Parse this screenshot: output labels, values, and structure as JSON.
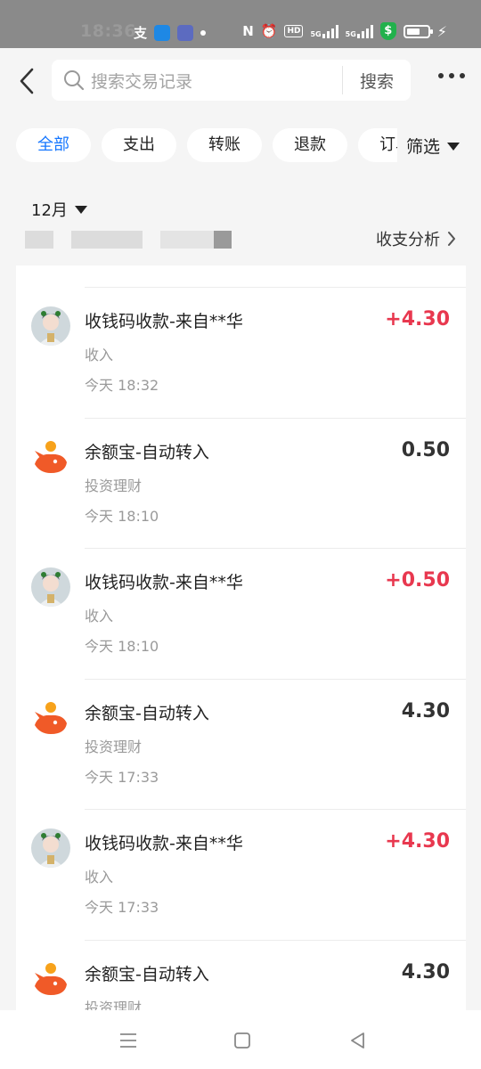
{
  "status_bar": {
    "time": "18:36",
    "network_label": "5G",
    "hd_label": "HD",
    "shield_symbol": "$"
  },
  "header": {
    "search_placeholder": "搜索交易记录",
    "search_button": "搜索"
  },
  "tabs": [
    "全部",
    "支出",
    "转账",
    "退款",
    "订单"
  ],
  "active_tab": "全部",
  "filter_label": "筛选",
  "month_label": "12月",
  "analysis_label": "收支分析",
  "colors": {
    "accent": "#1677ff",
    "income": "#e8384f",
    "yuebao": "#f05a28"
  },
  "transactions": [
    {
      "title": "收钱码收款-来自**华",
      "category": "收入",
      "time": "今天 18:32",
      "amount": "+4.30",
      "icon": "user-avatar"
    },
    {
      "title": "余额宝-自动转入",
      "category": "投资理财",
      "time": "今天 18:10",
      "amount": "0.50",
      "icon": "yuebao-icon"
    },
    {
      "title": "收钱码收款-来自**华",
      "category": "收入",
      "time": "今天 18:10",
      "amount": "+0.50",
      "icon": "user-avatar"
    },
    {
      "title": "余额宝-自动转入",
      "category": "投资理财",
      "time": "今天 17:33",
      "amount": "4.30",
      "icon": "yuebao-icon"
    },
    {
      "title": "收钱码收款-来自**华",
      "category": "收入",
      "time": "今天 17:33",
      "amount": "+4.30",
      "icon": "user-avatar"
    },
    {
      "title": "余额宝-自动转入",
      "category": "投资理财",
      "time": "",
      "amount": "4.30",
      "icon": "yuebao-icon"
    }
  ]
}
